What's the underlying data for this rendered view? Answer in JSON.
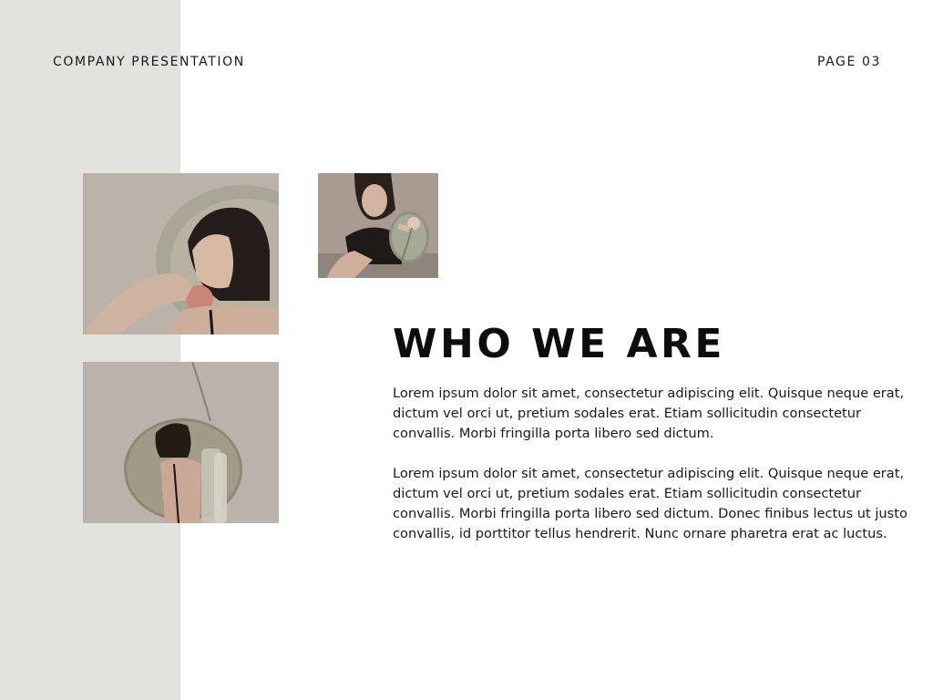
{
  "header": {
    "left_label": "COMPANY PRESENTATION",
    "right_label": "PAGE 03"
  },
  "main": {
    "title": "WHO WE ARE",
    "paragraphs": [
      "Lorem ipsum dolor sit amet, consectetur adipiscing elit. Quisque neque erat, dictum vel orci ut, pretium sodales erat. Etiam sollicitudin consectetur convallis. Morbi fringilla porta libero sed dictum.",
      "Lorem ipsum dolor sit amet, consectetur adipiscing elit. Quisque neque erat, dictum vel orci ut, pretium sodales erat. Etiam sollicitudin consectetur convallis. Morbi fringilla porta libero sed dictum. Donec finibus lectus ut justo convallis, id porttitor tellus hendrerit. Nunc ornare pharetra erat ac luctus."
    ]
  },
  "colors": {
    "side_band": "#e2e2de",
    "background": "#ffffff",
    "text": "#111111",
    "photo_tone": "#b9afa7"
  },
  "images": [
    {
      "name": "woman-with-mirror-and-apple-photo"
    },
    {
      "name": "woman-holding-mirror-with-flowers-photo"
    },
    {
      "name": "woman-reflected-in-round-mirror-photo"
    }
  ]
}
